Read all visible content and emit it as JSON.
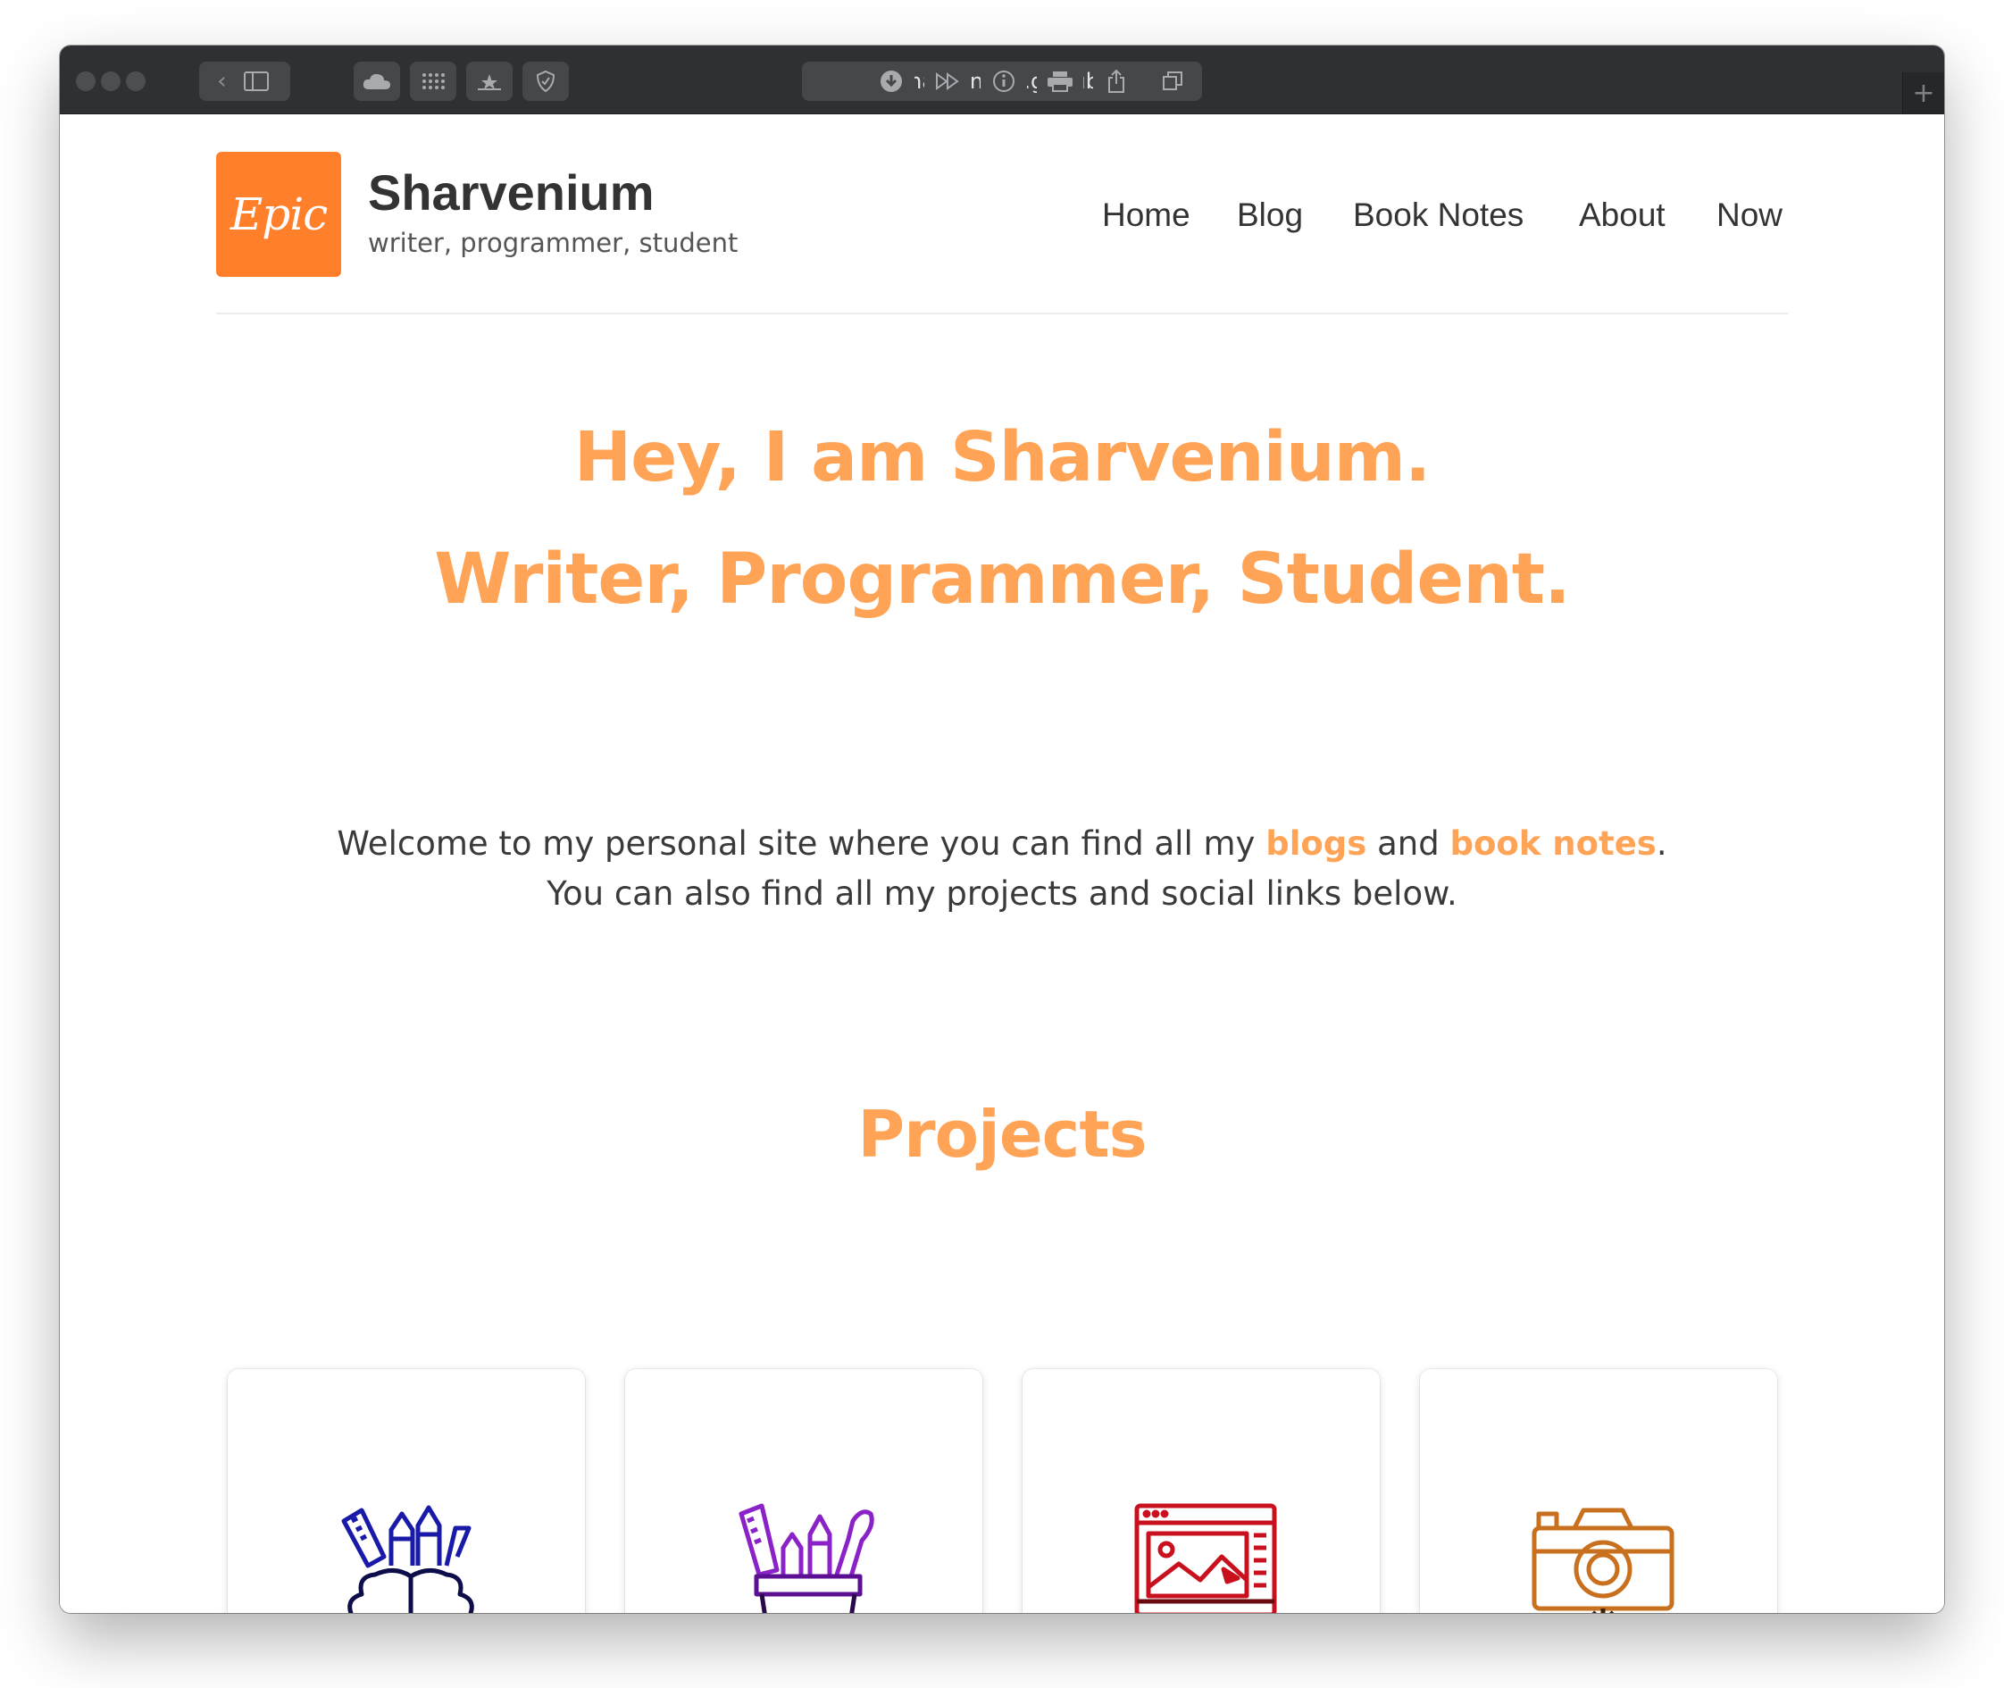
{
  "browser": {
    "url": "sharvenium.github.io"
  },
  "site": {
    "logo_text": "Epic",
    "title": "Sharvenium",
    "tagline": "writer, programmer, student"
  },
  "nav": {
    "home": "Home",
    "blog": "Blog",
    "book_notes": "Book Notes",
    "about": "About",
    "now": "Now"
  },
  "hero": {
    "line1": "Hey, I am Sharvenium.",
    "line2": "Writer, Programmer, Student."
  },
  "welcome": {
    "part1": "Welcome to my personal site where you can find all my ",
    "blogs_link": "blogs",
    "part2": " and ",
    "book_notes_link": "book notes",
    "part3": ".",
    "line2": "You can also find all my projects and social links below."
  },
  "projects": {
    "heading": "Projects",
    "cards": [
      {
        "icon": "brain-tools-icon",
        "color": "#1a1aa8"
      },
      {
        "icon": "pencil-cup-icon",
        "color": "#8a22c8"
      },
      {
        "icon": "design-monitor-icon",
        "color": "#c8101e"
      },
      {
        "icon": "camera-tripod-icon",
        "color": "#c8701e"
      }
    ]
  },
  "colors": {
    "accent": "#ffa456",
    "logo_bg": "#ff7f2a",
    "toolbar": "#2f3034"
  }
}
